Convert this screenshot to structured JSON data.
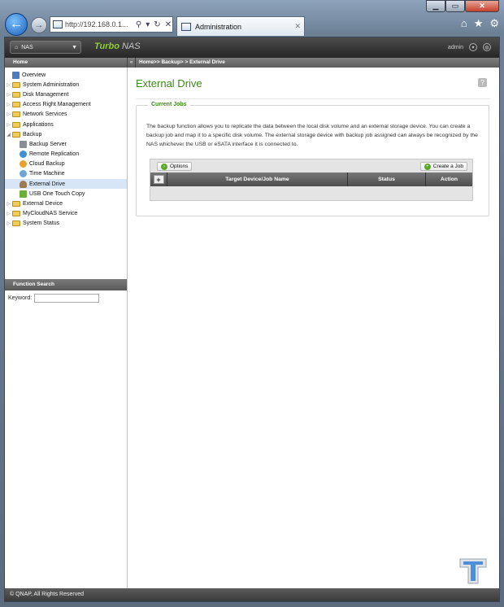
{
  "browser": {
    "address": "http://192.168.0.1...",
    "tab_title": "Administration",
    "back_icon": "back-arrow-icon",
    "forward_icon": "forward-arrow-icon"
  },
  "header": {
    "nas_menu": "NAS",
    "brand_turbo": "Turbo",
    "brand_nas": "NAS",
    "user": "admin"
  },
  "breadcrumb": {
    "home": "Home",
    "path": "Home>> Backup> > External Drive"
  },
  "sidebar": {
    "items": [
      {
        "label": "Overview"
      },
      {
        "label": "System Administration"
      },
      {
        "label": "Disk Management"
      },
      {
        "label": "Access Right Management"
      },
      {
        "label": "Network Services"
      },
      {
        "label": "Applications"
      },
      {
        "label": "Backup"
      },
      {
        "label": "Backup Server"
      },
      {
        "label": "Remote Replication"
      },
      {
        "label": "Cloud Backup"
      },
      {
        "label": "Time Machine"
      },
      {
        "label": "External Drive"
      },
      {
        "label": "USB One Touch Copy"
      },
      {
        "label": "External Device"
      },
      {
        "label": "MyCloudNAS Service"
      },
      {
        "label": "System Status"
      }
    ]
  },
  "function_search": {
    "title": "Function Search",
    "keyword_label": "Keyword:",
    "keyword_value": ""
  },
  "main": {
    "title": "External Drive",
    "section": "Current Jobs",
    "description": "The backup function allows you to replicate the data between the local disk volume and an external storage device. You can create a backup job and map it to a specific disk volume. The external storage device with backup job assigned can always be recognized by the NAS whichever the USB or eSATA interface it is connected to.",
    "options_btn": "Options",
    "create_btn": "Create a Job",
    "columns": [
      "Target Device/Job Name",
      "Status",
      "Action"
    ]
  },
  "footer": {
    "copyright": "© QNAP, All Rights Reserved"
  }
}
